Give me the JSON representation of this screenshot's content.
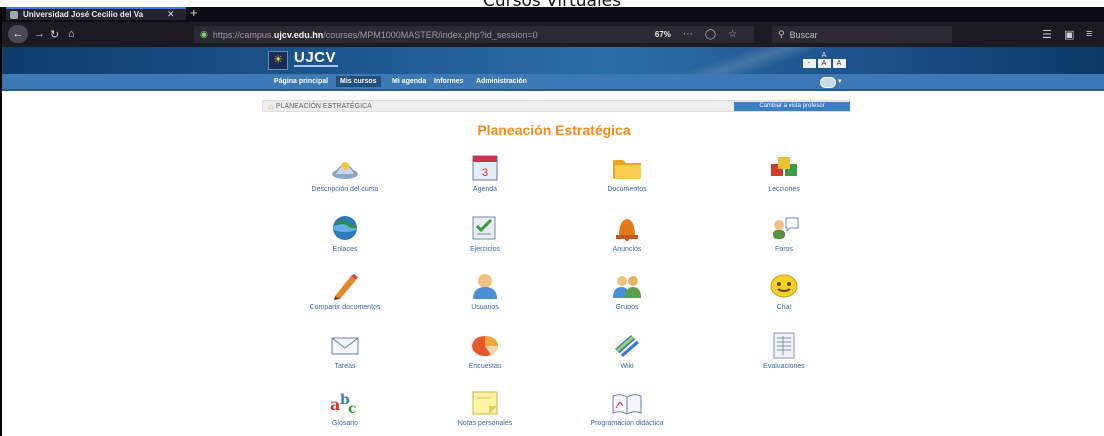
{
  "caption": "Cursos Virtuales",
  "browser": {
    "tab_title": "Universidad José Cecilio del Va",
    "tab_close": "✕",
    "new_tab": "+",
    "url_prefix": "https://campus.",
    "url_domain": "ujcv.edu.hn",
    "url_rest": "/courses/MPM1000MASTER/index.php?id_session=0",
    "zoom": "67%",
    "search_placeholder": "Buscar",
    "icons": [
      "back-icon",
      "reload-icon",
      "home-icon",
      "info-icon",
      "lock-icon",
      "more-icon",
      "pocket-icon",
      "bookmark-star-icon",
      "search-icon",
      "library-icon",
      "sidebar-icon",
      "menu-icon"
    ]
  },
  "site": {
    "logo_text": "UJCV",
    "logo_emblem": "☀",
    "font_tools_label": "A",
    "font_buttons": [
      "-",
      "A",
      "A"
    ]
  },
  "menu": {
    "items": [
      {
        "label": "Página principal",
        "active": false
      },
      {
        "label": "Mis cursos",
        "active": true
      },
      {
        "label": "Mi agenda",
        "active": false
      },
      {
        "label": "Informes",
        "active": false
      },
      {
        "label": "Administración",
        "active": false
      }
    ]
  },
  "breadcrumb": {
    "text": "PLANEACIÓN ESTRATÉGICA",
    "back_button": "Cambiar a vista profesor"
  },
  "page_title": "Planeación Estratégica",
  "tools": [
    {
      "label": "Descripción del curso",
      "icon": "course-description-icon"
    },
    {
      "label": "Agenda",
      "icon": "calendar-icon"
    },
    {
      "label": "Documentos",
      "icon": "folder-icon"
    },
    {
      "label": "Lecciones",
      "icon": "lessons-blocks-icon"
    },
    {
      "label": "Enlaces",
      "icon": "links-globe-icon"
    },
    {
      "label": "Ejercicios",
      "icon": "exercises-checklist-icon"
    },
    {
      "label": "Anuncios",
      "icon": "announcements-bell-icon"
    },
    {
      "label": "Foros",
      "icon": "forum-users-icon"
    },
    {
      "label": "Compartir documentos",
      "icon": "share-documents-pencil-icon"
    },
    {
      "label": "Usuarios",
      "icon": "user-icon"
    },
    {
      "label": "Grupos",
      "icon": "groups-icon"
    },
    {
      "label": "Chat",
      "icon": "chat-smiley-icon"
    },
    {
      "label": "Tareas",
      "icon": "assignments-envelope-icon"
    },
    {
      "label": "Encuestas",
      "icon": "surveys-pie-icon"
    },
    {
      "label": "Wiki",
      "icon": "wiki-book-icon"
    },
    {
      "label": "Evaluaciones",
      "icon": "gradebook-icon"
    },
    {
      "label": "Glosario",
      "icon": "glossary-abc-icon"
    },
    {
      "label": "Notas personales",
      "icon": "notes-icon"
    },
    {
      "label": "Programación didáctica",
      "icon": "course-progress-book-icon"
    }
  ]
}
